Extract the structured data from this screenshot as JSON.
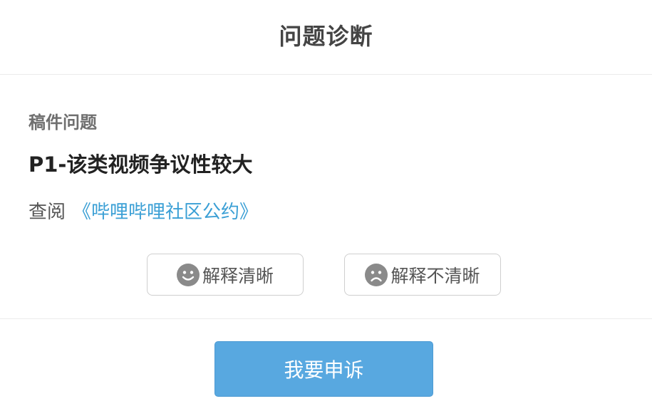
{
  "header": {
    "title": "问题诊断"
  },
  "content": {
    "section_label": "稿件问题",
    "problem_title": "P1-该类视频争议性较大",
    "refer_prefix": "查阅",
    "refer_link": "《哔哩哔哩社区公约》"
  },
  "feedback": {
    "clear_label": "解释清晰",
    "unclear_label": "解释不清晰",
    "clear_icon": "smile-icon",
    "unclear_icon": "frown-icon"
  },
  "footer": {
    "appeal_label": "我要申诉"
  },
  "colors": {
    "link": "#3a9fd5",
    "primary_button": "#58a8e0",
    "icon_gray": "#8a8a8a"
  }
}
